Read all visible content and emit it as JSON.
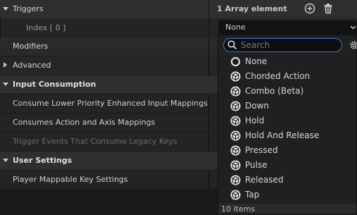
{
  "rows": {
    "triggers": "Triggers",
    "array_count": "1 Array element",
    "index": "Index [ 0 ]",
    "modifiers": "Modifiers",
    "advanced": "Advanced",
    "input_consumption": "Input Consumption",
    "consume_lower": "Consume Lower Priority Enhanced Input Mappings",
    "consumes_action": "Consumes Action and Axis Mappings",
    "trigger_events": "Trigger Events That Consume Legacy Keys",
    "user_settings": "User Settings",
    "player_mappable": "Player Mappable Key Settings"
  },
  "combo": {
    "selected": "None"
  },
  "search": {
    "placeholder": "Search"
  },
  "items": [
    "None",
    "Chorded Action",
    "Combo (Beta)",
    "Down",
    "Hold",
    "Hold And Release",
    "Pressed",
    "Pulse",
    "Released",
    "Tap"
  ],
  "footer": "10 items",
  "icons": {
    "add": "add-element-icon",
    "delete": "trash-icon",
    "dropdown": "chevron-down-icon",
    "search": "search-icon",
    "settings": "gear-icon",
    "none_item": "ring-icon",
    "class_item": "class-blueprint-icon"
  }
}
